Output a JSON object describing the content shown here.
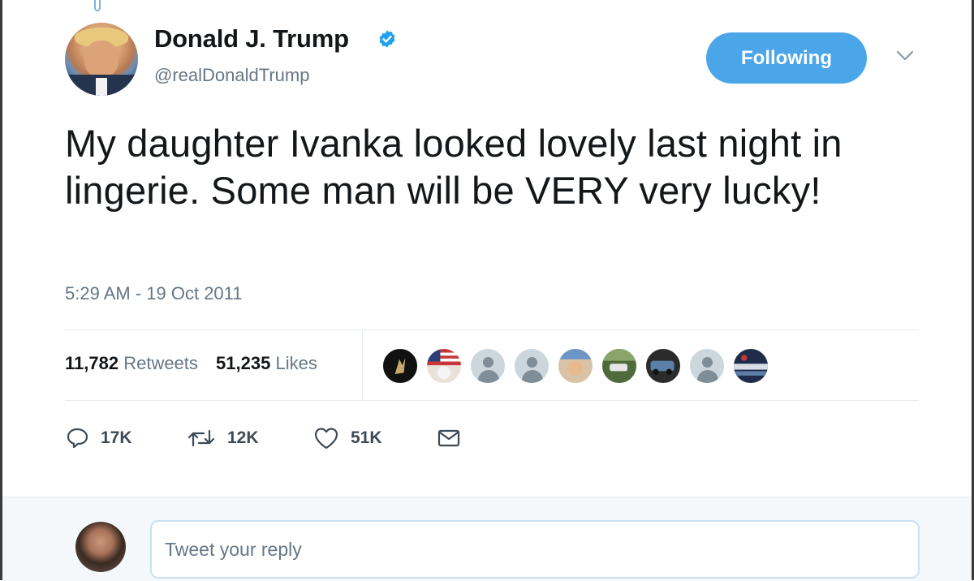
{
  "author": {
    "name": "Donald J. Trump",
    "handle": "@realDonaldTrump",
    "verified": true
  },
  "follow_button": {
    "label": "Following"
  },
  "tweet": {
    "text": "My daughter Ivanka looked lovely last night in lingerie. Some man will be VERY very lucky!",
    "timestamp": "5:29 AM - 19 Oct 2011"
  },
  "stats": {
    "retweets_count": "11,782",
    "retweets_label": "Retweets",
    "likes_count": "51,235",
    "likes_label": "Likes"
  },
  "actions": {
    "reply_count": "17K",
    "retweet_count": "12K",
    "like_count": "51K"
  },
  "reply": {
    "placeholder": "Tweet your reply"
  },
  "colors": {
    "accent": "#4aa6e8",
    "muted_text": "#657786",
    "divider": "#e6ecf0"
  },
  "icons": [
    "verified-badge-icon",
    "chevron-down-icon",
    "reply-icon",
    "retweet-icon",
    "like-icon",
    "direct-message-icon"
  ]
}
